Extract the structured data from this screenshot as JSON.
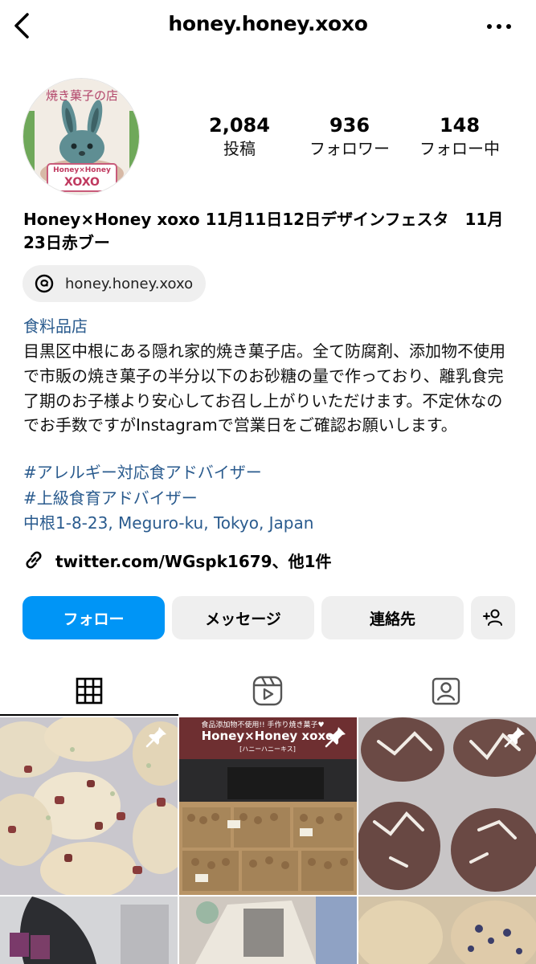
{
  "header": {
    "username": "honey.honey.xoxo"
  },
  "avatar": {
    "banner_text": "焼き菓子の店",
    "sign_line1": "Honey×Honey",
    "sign_line2": "XOXO"
  },
  "stats": [
    {
      "value": "2,084",
      "label": "投稿"
    },
    {
      "value": "936",
      "label": "フォロワー"
    },
    {
      "value": "148",
      "label": "フォロー中"
    }
  ],
  "bio": {
    "name": "Honey×Honey xoxo 11月11日12日デザインフェスタ　11月23日赤ブー",
    "threads": "honey.honey.xoxo",
    "category": "食料品店",
    "text": "目黒区中根にある隠れ家的焼き菓子店。全て防腐剤、添加物不使用で市販の焼き菓子の半分以下のお砂糖の量で作っており、離乳食完了期のお子様より安心してお召し上がりいただけます。不定休なのでお手数ですがInstagramで営業日をご確認お願いします。",
    "hashtag1": "#アレルギー対応食アドバイザー",
    "hashtag2": "#上級食育アドバイザー",
    "address": "中根1-8-23, Meguro-ku, Tokyo, Japan",
    "link": "twitter.com/WGspk1679、他1件"
  },
  "buttons": {
    "follow": "フォロー",
    "message": "メッセージ",
    "contact": "連絡先"
  },
  "tabs": [
    "grid-icon",
    "reels-icon",
    "tagged-icon"
  ],
  "posts": {
    "post2_banner_top": "食品添加物不使用!!  手作り焼き菓子♥",
    "post2_banner_main": "Honey×Honey xoxo",
    "post2_banner_sub": "[ハニーハニーキス]"
  },
  "colors": {
    "accent_blue": "#0095f6",
    "link_blue": "#2a5b8e",
    "button_gray": "#efefef"
  }
}
